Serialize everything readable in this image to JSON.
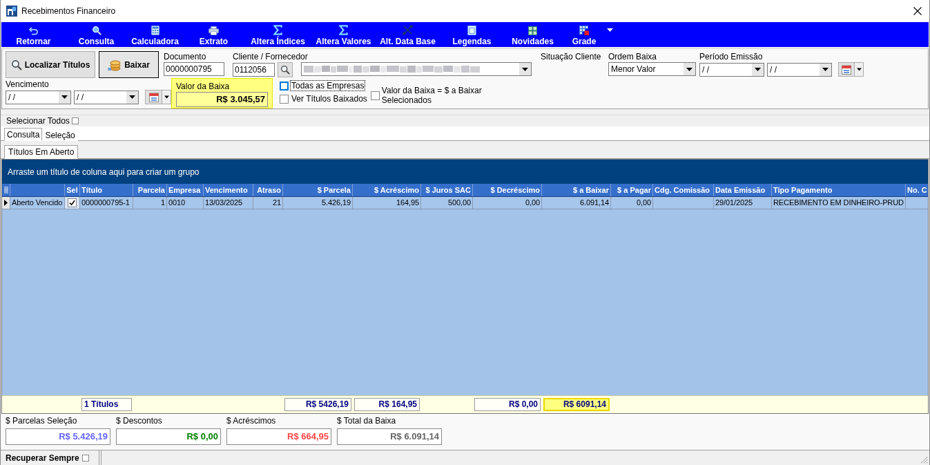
{
  "window": {
    "title": "Recebimentos Financeiro"
  },
  "toolbar": [
    {
      "label": "Retornar"
    },
    {
      "label": "Consulta"
    },
    {
      "label": "Calculadora"
    },
    {
      "label": "Extrato"
    },
    {
      "label": "Altera Índices"
    },
    {
      "label": "Altera Valores"
    },
    {
      "label": "Alt. Data Base"
    },
    {
      "label": "Legendas"
    },
    {
      "label": "Novidades"
    },
    {
      "label": "Grade"
    }
  ],
  "filters": {
    "buttons": [
      {
        "label": "Localizar Títulos",
        "focused": false
      },
      {
        "label": "Baixar",
        "focused": true
      }
    ],
    "documento": {
      "label": "Documento",
      "value": "0000000795"
    },
    "cliente": {
      "label": "Cliente / Fornecedor",
      "value": "0112056"
    },
    "situacao_cliente": {
      "label": "Situação Cliente"
    },
    "ordem_baixa": {
      "label": "Ordem Baixa",
      "value": "Menor Valor"
    },
    "periodo_emissao": {
      "label": "Período Emissão",
      "from": "/ /",
      "to": "/ /"
    },
    "vencimento": {
      "label": "Vencimento",
      "from": "/ /",
      "to": "/ /"
    },
    "valor_baixa": {
      "label": "Valor da Baixa",
      "value": "R$ 3.045,57",
      "highlighted": true
    },
    "options": [
      {
        "label": "Todas as Empresas",
        "checked": false,
        "focused": true
      },
      {
        "label": "Ver Títulos Baixados",
        "checked": false,
        "focused": false
      }
    ],
    "valor_igual": {
      "label": "Valor da Baixa = $ a Baixar Selecionados",
      "checked": false
    }
  },
  "select_all": {
    "label": "Selecionar Todos",
    "checked": false
  },
  "tabs": [
    {
      "label": "Consulta",
      "selected": true
    },
    {
      "label": "Seleção",
      "selected": false
    }
  ],
  "subtabs": [
    {
      "label": "Títulos Em Aberto",
      "selected": true
    }
  ],
  "grid": {
    "group_hint": "Arraste um título de coluna aqui para criar um grupo",
    "rows": [
      {
        "current": true
      }
    ],
    "columns": [
      {
        "kind": "text",
        "cells": [
          "Aberto Vencido"
        ]
      },
      {
        "label": "Sel",
        "kind": "check",
        "cells": [
          true
        ]
      },
      {
        "label": "Título",
        "kind": "text",
        "cells": [
          "0000000795-1"
        ],
        "total": {
          "text": "1 Títulos",
          "highlighted": false
        }
      },
      {
        "label": "Parcela",
        "kind": "number",
        "cells": [
          "1"
        ]
      },
      {
        "label": "Empresa",
        "kind": "text",
        "cells": [
          "0010"
        ]
      },
      {
        "label": "Vencimento",
        "kind": "text",
        "cells": [
          "13/03/2025"
        ]
      },
      {
        "label": "Atraso",
        "kind": "number",
        "cells": [
          "21"
        ]
      },
      {
        "label": "$ Parcela",
        "kind": "number",
        "cells": [
          "5.426,19"
        ],
        "total": {
          "text": "R$ 5426,19",
          "highlighted": false
        }
      },
      {
        "label": "$ Acréscimo",
        "kind": "number",
        "cells": [
          "164,95"
        ],
        "total": {
          "text": "R$ 164,95",
          "highlighted": false
        }
      },
      {
        "label": "$ Juros SAC",
        "kind": "number",
        "cells": [
          "500,00"
        ]
      },
      {
        "label": "$ Decréscimo",
        "kind": "number",
        "cells": [
          "0,00"
        ],
        "total": {
          "text": "R$ 0,00",
          "highlighted": false
        }
      },
      {
        "label": "$ a Baixar",
        "kind": "number",
        "cells": [
          "6.091,14"
        ],
        "total": {
          "text": "R$ 6091,14",
          "highlighted": true
        }
      },
      {
        "label": "$ a Pagar",
        "kind": "number",
        "cells": [
          "0,00"
        ]
      },
      {
        "label": "Cdg. Comissão",
        "kind": "text"
      },
      {
        "label": "Data Emissão",
        "kind": "text",
        "cells": [
          "29/01/2025"
        ]
      },
      {
        "label": "Tipo Pagamento",
        "kind": "text",
        "cells": [
          "RECEBIMENTO EM DINHEIRO-PRUD"
        ]
      },
      {
        "label": "No. C",
        "kind": "text"
      }
    ]
  },
  "summary": [
    {
      "label": "$ Parcelas Seleção",
      "value": "R$ 5.426,19",
      "color": "#6464ff"
    },
    {
      "label": "$ Descontos",
      "value": "R$ 0,00",
      "color": "#008000"
    },
    {
      "label": "$ Acréscimos",
      "value": "R$ 664,95",
      "color": "#ff4646"
    },
    {
      "label": "$ Total da Baixa",
      "value": "R$ 6.091,14",
      "color": "#646464"
    }
  ],
  "status_bar": {
    "label": "Recuperar Sempre",
    "checked": false
  }
}
